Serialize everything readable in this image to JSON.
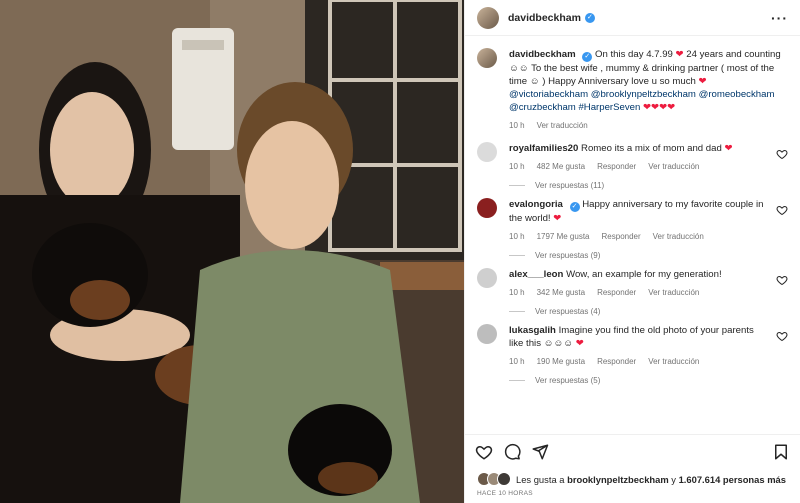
{
  "author": {
    "username": "davidbeckham",
    "verified": true
  },
  "caption": {
    "username": "davidbeckham",
    "text_part1": "On this day 4.7.99 ",
    "text_part2": " 24 years and counting ",
    "text_part3": " To the best wife , mummy & drinking partner ( most of the time ",
    "text_part4": " ) Happy Anniversary love u so much ",
    "mentions": "@victoriabeckham @brooklynpeltzbeckham @romeobeckham @cruzbeckham #HarperSeven",
    "time": "10 h",
    "translate": "Ver traducción"
  },
  "comments": [
    {
      "username": "royalfamilies20",
      "text": "Romeo its a mix of mom and dad",
      "time": "10 h",
      "likes": "482 Me gusta",
      "reply": "Responder",
      "translate": "Ver traducción",
      "replies": "Ver respuestas (11)",
      "verified": false
    },
    {
      "username": "evalongoria",
      "text": "Happy anniversary to my favorite couple in the world!",
      "time": "10 h",
      "likes": "1797 Me gusta",
      "reply": "Responder",
      "translate": "Ver traducción",
      "replies": "Ver respuestas (9)",
      "verified": true
    },
    {
      "username": "alex___leon",
      "text": "Wow, an example for my generation!",
      "time": "10 h",
      "likes": "342 Me gusta",
      "reply": "Responder",
      "translate": "Ver traducción",
      "replies": "Ver respuestas (4)",
      "verified": false
    },
    {
      "username": "lukasgalih",
      "text": "Imagine you find the old photo of your parents like this",
      "time": "10 h",
      "likes": "190 Me gusta",
      "reply": "Responder",
      "translate": "Ver traducción",
      "replies": "Ver respuestas (5)",
      "verified": false
    }
  ],
  "liked_by": {
    "prefix": "Les gusta a",
    "user": "brooklynpeltzbeckham",
    "conj": "y",
    "count": "1.607.614 personas más"
  },
  "posted": "HACE 10 HORAS",
  "colors": {
    "verified": "#3897f0",
    "heart": "#ed1c3f",
    "link": "#00376b",
    "muted": "#737373"
  }
}
